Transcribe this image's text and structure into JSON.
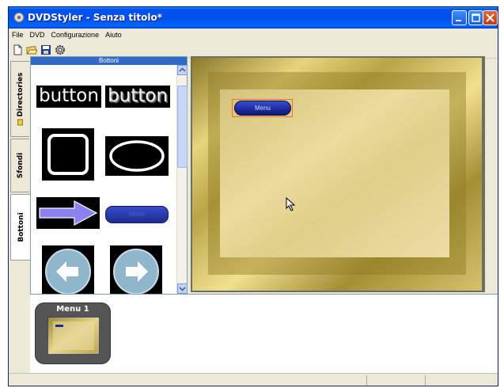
{
  "window": {
    "title": "DVDStyler - Senza titolo*"
  },
  "menubar": {
    "items": [
      "File",
      "DVD",
      "Configurazione",
      "Aiuto"
    ]
  },
  "toolbar": {
    "icons": [
      "new-file-icon",
      "open-folder-icon",
      "save-icon",
      "settings-icon"
    ]
  },
  "side_tabs": [
    "Directories",
    "Sfondi",
    "Bottoni"
  ],
  "active_tab": "Bottoni",
  "buttons_panel": {
    "header": "Bottoni",
    "items": [
      {
        "type": "text-button",
        "label": "button"
      },
      {
        "type": "text-button-shadow",
        "label": "button"
      },
      {
        "type": "rounded-square"
      },
      {
        "type": "ellipse"
      },
      {
        "type": "arrow"
      },
      {
        "type": "menu-pill",
        "label": "Menu"
      },
      {
        "type": "circle-arrow-left"
      },
      {
        "type": "circle-arrow-right"
      }
    ]
  },
  "canvas": {
    "menu_button_label": "Menu"
  },
  "menus": [
    {
      "label": "Menu 1"
    }
  ],
  "colors": {
    "titlebar": "#0053ee",
    "selection_header": "#316ac5",
    "gold": "#c9b45a",
    "menu_button": "#1a2a9e",
    "selection_outline": "#e8742c"
  }
}
